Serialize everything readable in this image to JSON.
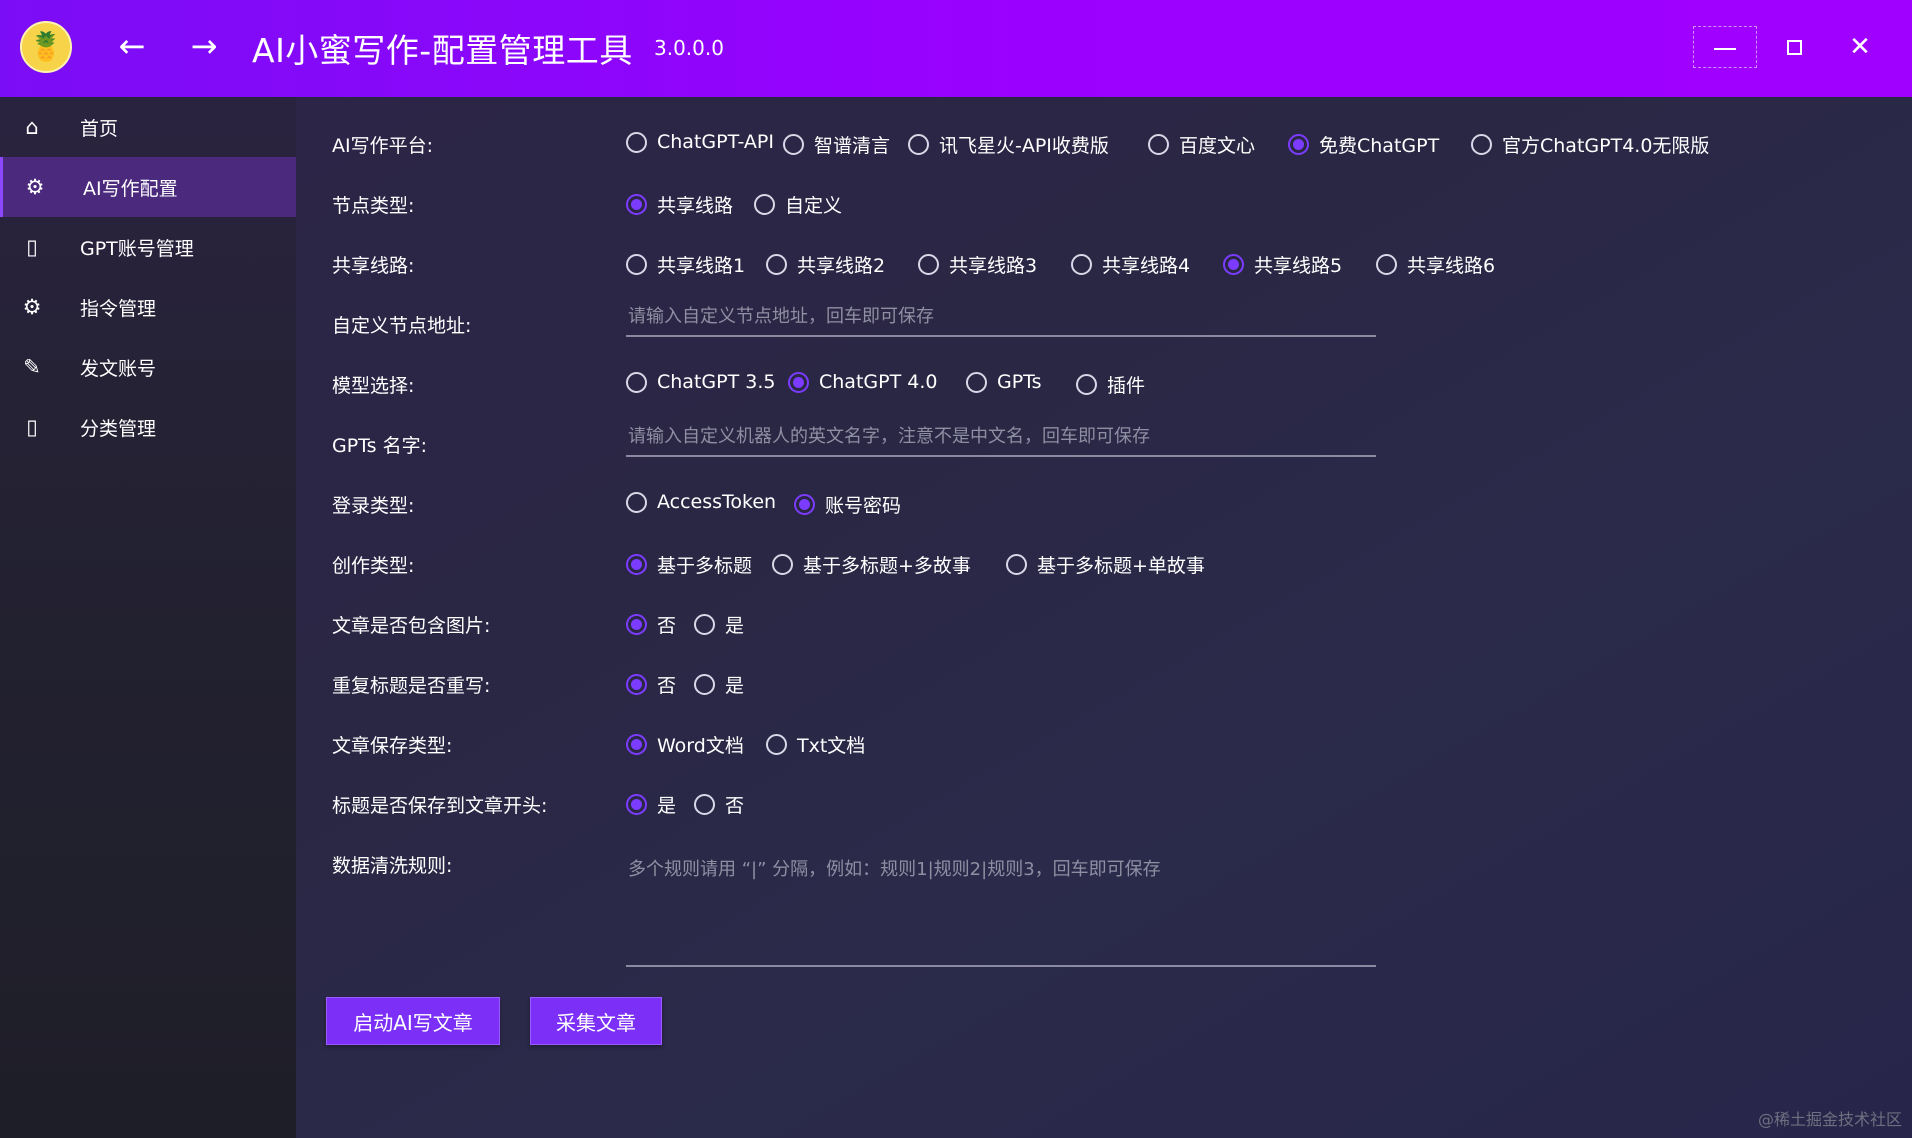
{
  "window": {
    "title": "AI小蜜写作-配置管理工具",
    "version": "3.0.0.0",
    "back_icon": "←",
    "forward_icon": "→",
    "close_icon": "✕",
    "logo_icon": "🍍"
  },
  "sidebar": {
    "items": [
      {
        "label": "首页",
        "icon": "⌂"
      },
      {
        "label": "AI写作配置",
        "icon": "⚙"
      },
      {
        "label": "GPT账号管理",
        "icon": "▯"
      },
      {
        "label": "指令管理",
        "icon": "⚙"
      },
      {
        "label": "发文账号",
        "icon": "✎"
      },
      {
        "label": "分类管理",
        "icon": "▯"
      }
    ],
    "active_index": 1
  },
  "form": {
    "platform": {
      "label": "AI写作平台:",
      "options": [
        "ChatGPT-API",
        "智谱清言",
        "讯飞星火-API收费版",
        "百度文心",
        "免费ChatGPT",
        "官方ChatGPT4.0无限版"
      ],
      "selected": 4
    },
    "node_type": {
      "label": "节点类型:",
      "options": [
        "共享线路",
        "自定义"
      ],
      "selected": 0
    },
    "shared_line": {
      "label": "共享线路:",
      "options": [
        "共享线路1",
        "共享线路2",
        "共享线路3",
        "共享线路4",
        "共享线路5",
        "共享线路6"
      ],
      "selected": 4
    },
    "custom_node": {
      "label": "自定义节点地址:",
      "placeholder": "请输入自定义节点地址，回车即可保存"
    },
    "model": {
      "label": "模型选择:",
      "options": [
        "ChatGPT 3.5",
        "ChatGPT 4.0",
        "GPTs",
        "插件"
      ],
      "selected": 1
    },
    "gpts_name": {
      "label": "GPTs 名字:",
      "placeholder": "请输入自定义机器人的英文名字，注意不是中文名，回车即可保存"
    },
    "login_type": {
      "label": "登录类型:",
      "options": [
        "AccessToken",
        "账号密码"
      ],
      "selected": 1
    },
    "creation_type": {
      "label": "创作类型:",
      "options": [
        "基于多标题",
        "基于多标题+多故事",
        "基于多标题+单故事"
      ],
      "selected": 0
    },
    "include_image": {
      "label": "文章是否包含图片:",
      "options": [
        "否",
        "是"
      ],
      "selected": 0
    },
    "rewrite_duplicate": {
      "label": "重复标题是否重写:",
      "options": [
        "否",
        "是"
      ],
      "selected": 0
    },
    "save_type": {
      "label": "文章保存类型:",
      "options": [
        "Word文档",
        "Txt文档"
      ],
      "selected": 0
    },
    "title_at_start": {
      "label": "标题是否保存到文章开头:",
      "options": [
        "是",
        "否"
      ],
      "selected": 0
    },
    "cleaning_rules": {
      "label": "数据清洗规则:",
      "placeholder": "多个规则请用 “|” 分隔，例如：规则1|规则2|规则3，回车即可保存"
    }
  },
  "actions": {
    "start_label": "启动AI写文章",
    "collect_label": "采集文章"
  },
  "watermark": "@稀土掘金技术社区",
  "colors": {
    "accent": "#7c3cff",
    "titlebar": "#9b00ff",
    "sidebar_active": "#4b2a7e"
  }
}
